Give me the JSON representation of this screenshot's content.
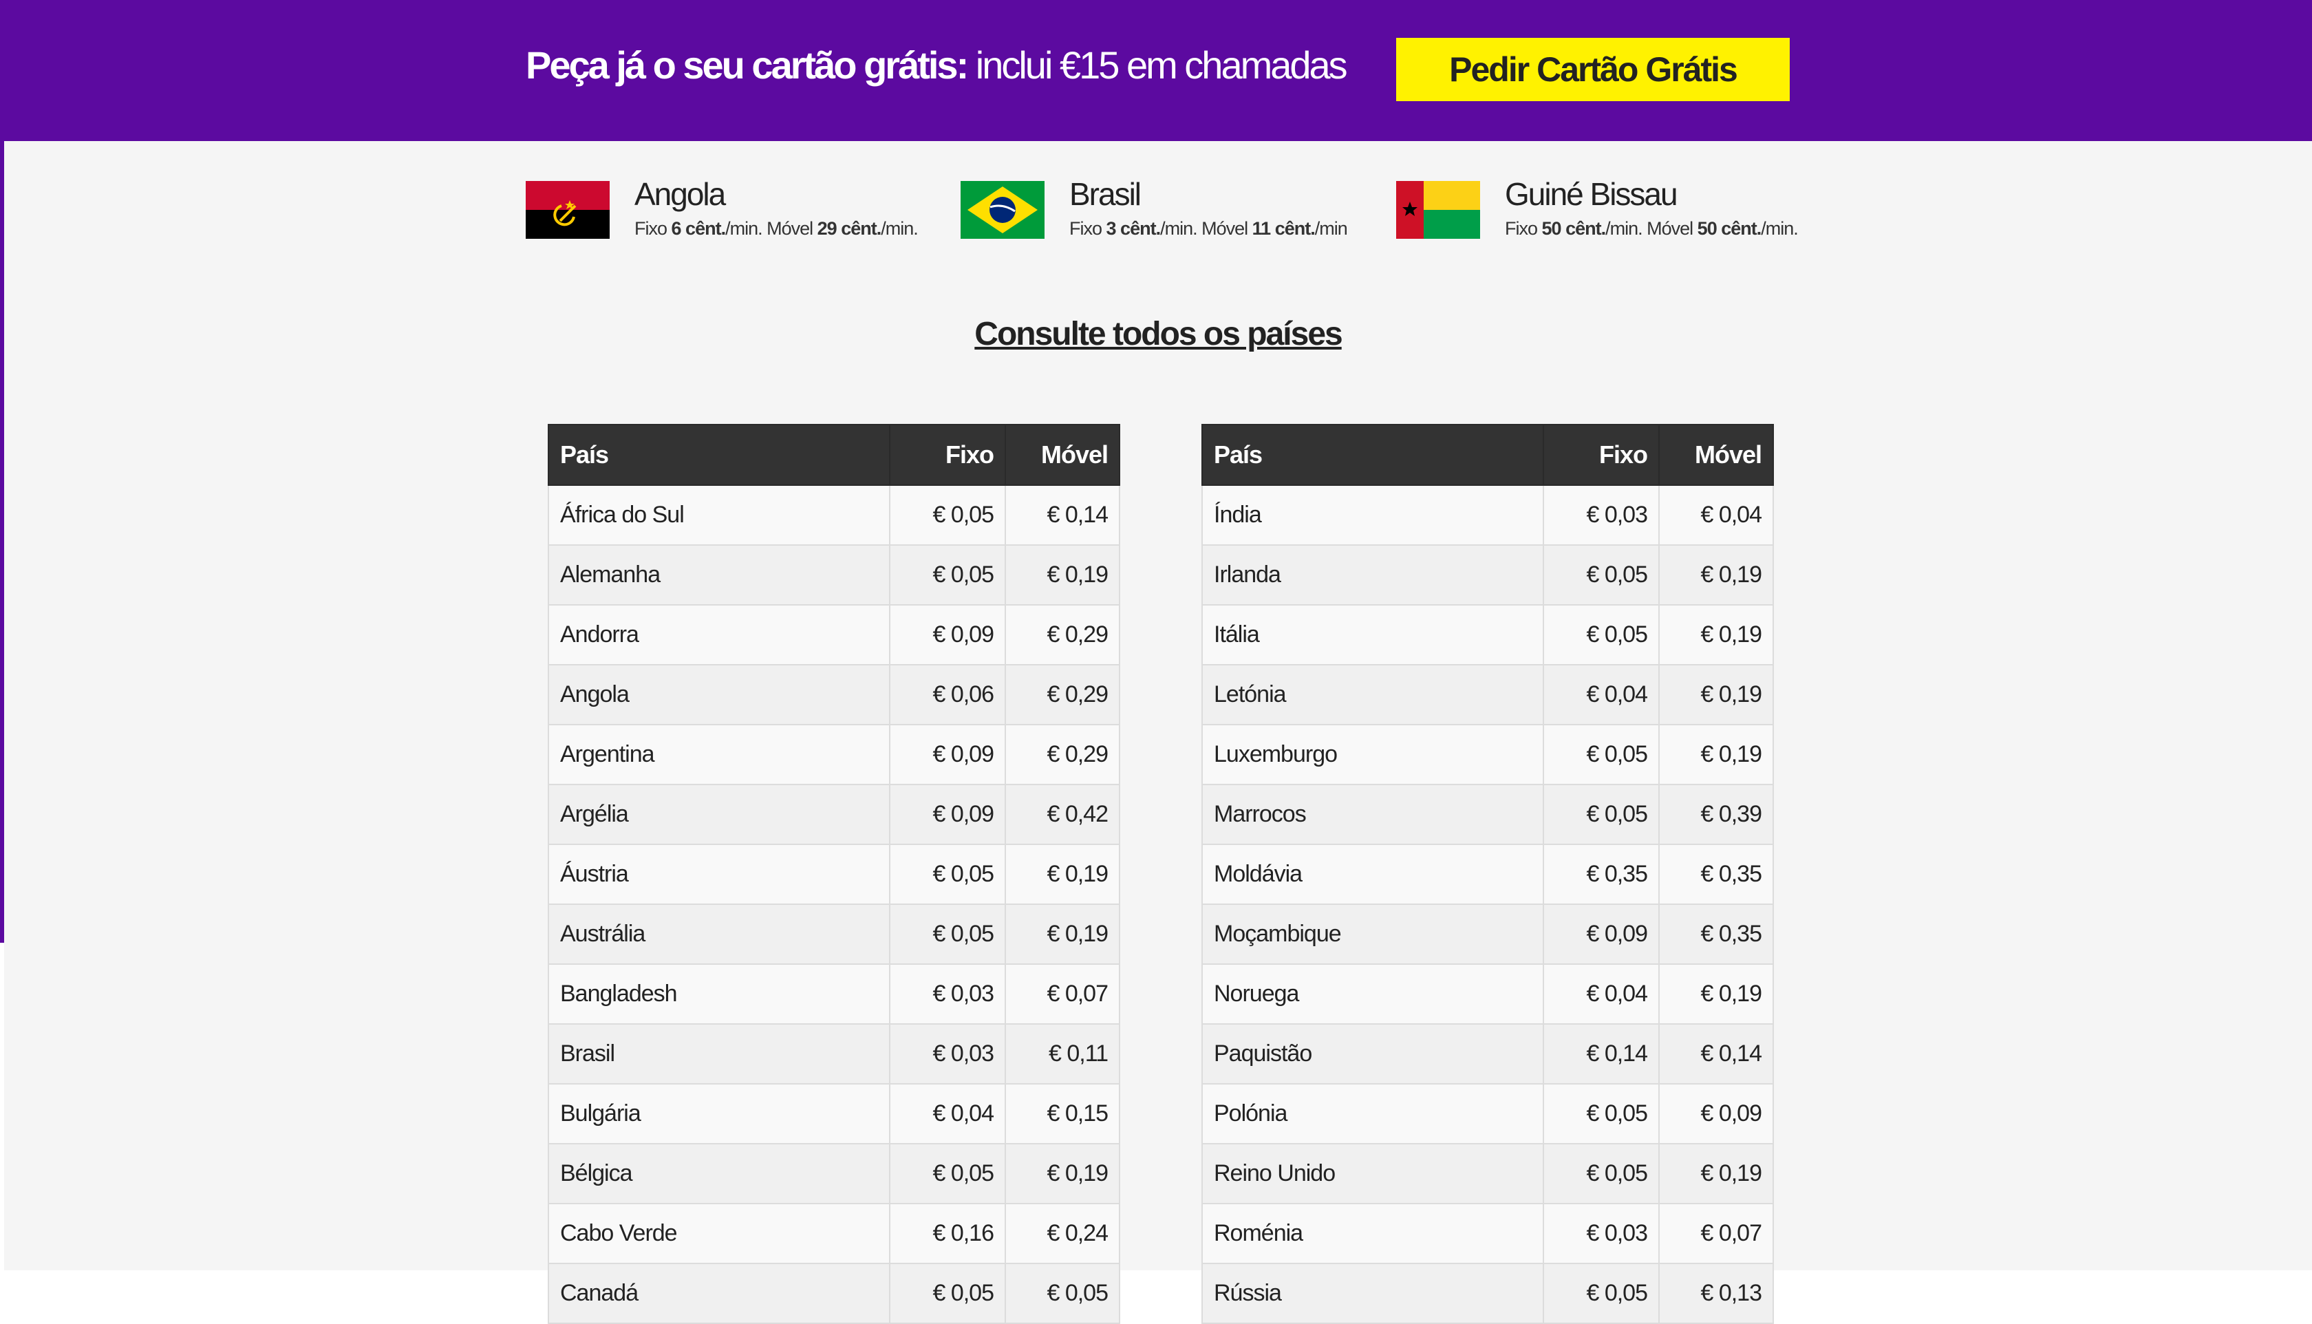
{
  "header": {
    "promo_bold": "Peça já o seu cartão grátis:",
    "promo_rest": " inclui €15 em chamadas",
    "cta_label": "Pedir Cartão Grátis"
  },
  "featured": [
    {
      "name": "Angola",
      "fixo_label": "Fixo",
      "fixo": "6 cênt.",
      "movel_label": "Móvel",
      "movel": "29 cênt.",
      "unit": "/min.",
      "flag": "angola-flag"
    },
    {
      "name": "Brasil",
      "fixo_label": "Fixo",
      "fixo": "3 cênt.",
      "movel_label": "Móvel",
      "movel": "11 cênt.",
      "unit": "/min",
      "flag": "brazil-flag"
    },
    {
      "name": "Guiné Bissau",
      "fixo_label": "Fixo",
      "fixo": "50 cênt.",
      "movel_label": "Móvel",
      "movel": "50 cênt.",
      "unit": "/min.",
      "flag": "guinea-bissau-flag"
    }
  ],
  "all_countries_link": "Consulte todos os países",
  "columns": {
    "country": "País",
    "fixo": "Fixo",
    "movel": "Móvel"
  },
  "table_left": [
    [
      "África do Sul",
      "€ 0,05",
      "€ 0,14"
    ],
    [
      "Alemanha",
      "€ 0,05",
      "€ 0,19"
    ],
    [
      "Andorra",
      "€ 0,09",
      "€ 0,29"
    ],
    [
      "Angola",
      "€ 0,06",
      "€ 0,29"
    ],
    [
      "Argentina",
      "€ 0,09",
      "€ 0,29"
    ],
    [
      "Argélia",
      "€ 0,09",
      "€ 0,42"
    ],
    [
      "Áustria",
      "€ 0,05",
      "€ 0,19"
    ],
    [
      "Austrália",
      "€ 0,05",
      "€ 0,19"
    ],
    [
      "Bangladesh",
      "€ 0,03",
      "€ 0,07"
    ],
    [
      "Brasil",
      "€ 0,03",
      "€ 0,11"
    ],
    [
      "Bulgária",
      "€ 0,04",
      "€ 0,15"
    ],
    [
      "Bélgica",
      "€ 0,05",
      "€ 0,19"
    ],
    [
      "Cabo Verde",
      "€ 0,16",
      "€ 0,24"
    ],
    [
      "Canadá",
      "€ 0,05",
      "€ 0,05"
    ]
  ],
  "table_right": [
    [
      "Índia",
      "€ 0,03",
      "€ 0,04"
    ],
    [
      "Irlanda",
      "€ 0,05",
      "€ 0,19"
    ],
    [
      "Itália",
      "€ 0,05",
      "€ 0,19"
    ],
    [
      "Letónia",
      "€ 0,04",
      "€ 0,19"
    ],
    [
      "Luxemburgo",
      "€ 0,05",
      "€ 0,19"
    ],
    [
      "Marrocos",
      "€ 0,05",
      "€ 0,39"
    ],
    [
      "Moldávia",
      "€ 0,35",
      "€ 0,35"
    ],
    [
      "Moçambique",
      "€ 0,09",
      "€ 0,35"
    ],
    [
      "Noruega",
      "€ 0,04",
      "€ 0,19"
    ],
    [
      "Paquistão",
      "€ 0,14",
      "€ 0,14"
    ],
    [
      "Polónia",
      "€ 0,05",
      "€ 0,09"
    ],
    [
      "Reino Unido",
      "€ 0,05",
      "€ 0,19"
    ],
    [
      "Roménia",
      "€ 0,03",
      "€ 0,07"
    ],
    [
      "Rússia",
      "€ 0,05",
      "€ 0,13"
    ]
  ],
  "colors": {
    "brand_purple": "#5c0aa0",
    "cta_yellow": "#fff200",
    "table_header": "#333333"
  }
}
